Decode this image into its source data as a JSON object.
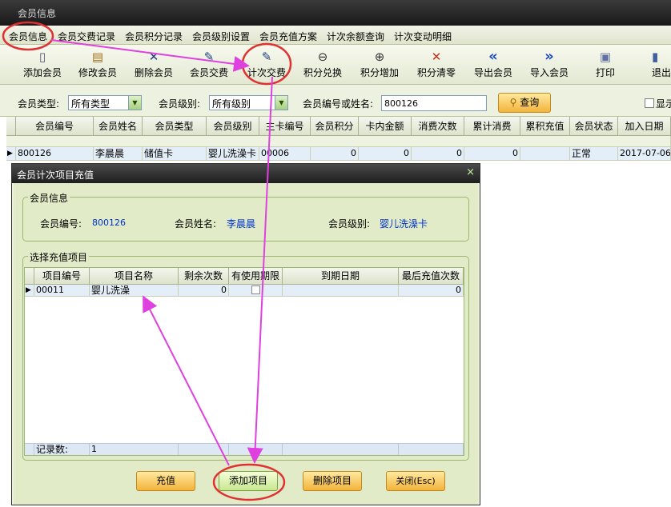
{
  "window": {
    "title": "会员信息"
  },
  "tabs": [
    "会员信息",
    "会员交费记录",
    "会员积分记录",
    "会员级别设置",
    "会员充值方案",
    "计次余额查询",
    "计次变动明细"
  ],
  "toolbar": [
    {
      "label": "添加会员",
      "icon": "▯"
    },
    {
      "label": "修改会员",
      "icon": "▤"
    },
    {
      "label": "删除会员",
      "icon": "✕"
    },
    {
      "label": "会员交费",
      "icon": "✎"
    },
    {
      "label": "计次交费",
      "icon": "✎"
    },
    {
      "label": "积分兑换",
      "icon": "⊖"
    },
    {
      "label": "积分增加",
      "icon": "⊕"
    },
    {
      "label": "积分清零",
      "icon": "✕"
    },
    {
      "label": "导出会员",
      "icon": "«"
    },
    {
      "label": "导入会员",
      "icon": "»"
    },
    {
      "label": "打印",
      "icon": "▣"
    },
    {
      "label": "退出",
      "icon": "▮"
    }
  ],
  "filters": {
    "type_label": "会员类型:",
    "type_value": "所有类型",
    "level_label": "会员级别:",
    "level_value": "所有级别",
    "search_label": "会员编号或姓名:",
    "search_value": "800126",
    "query_button": "查询",
    "show_label": "显示"
  },
  "member_grid": {
    "columns": [
      "会员编号",
      "会员姓名",
      "会员类型",
      "会员级别",
      "主卡编号",
      "会员积分",
      "卡内金额",
      "消费次数",
      "累计消费",
      "累积充值",
      "会员状态",
      "加入日期"
    ],
    "rows": [
      [
        "800126",
        "李晨晨",
        "储值卡",
        "婴儿洗澡卡",
        "00006",
        "0",
        "0",
        "0",
        "0",
        "",
        "正常",
        "2017-07-06"
      ]
    ]
  },
  "dialog": {
    "title": "会员计次项目充值",
    "close": "×",
    "member_info_title": "会员信息",
    "member_no_label": "会员编号:",
    "member_no": "800126",
    "member_name_label": "会员姓名:",
    "member_name": "李晨晨",
    "member_level_label": "会员级别:",
    "member_level": "婴儿洗澡卡",
    "select_title": "选择充值项目",
    "items": {
      "columns": [
        "项目编号",
        "项目名称",
        "剩余次数",
        "有使用期限",
        "到期日期",
        "最后充值次数"
      ],
      "rows": [
        {
          "code": "00011",
          "name": "婴儿洗澡",
          "remaining": "0",
          "expiry": "",
          "last_count": "0"
        }
      ],
      "footer_label": "记录数:",
      "footer_count": "1"
    },
    "buttons": {
      "recharge": "充值",
      "add_item": "添加项目",
      "delete_item": "删除项目",
      "close": "关闭(Esc)"
    }
  },
  "colors": {
    "annotation": "#e040e0",
    "highlight_circle": "#e03030",
    "accent_button": "#f3b43c"
  }
}
